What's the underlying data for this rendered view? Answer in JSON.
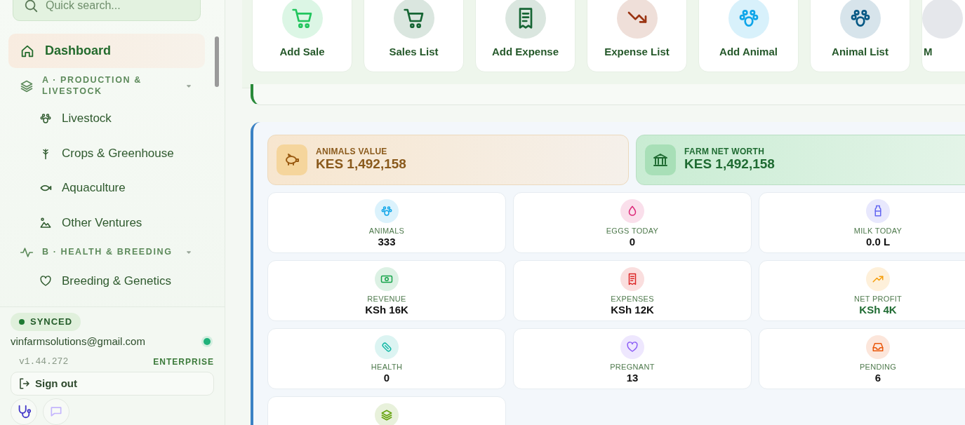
{
  "sidebar": {
    "search": {
      "placeholder": "Quick search..."
    },
    "items": [
      {
        "kind": "link",
        "label": "Dashboard",
        "selected": true
      },
      {
        "kind": "section",
        "label": "A · PRODUCTION & LIVESTOCK",
        "expanded": true,
        "children": [
          {
            "kind": "link",
            "label": "Livestock",
            "selected": false
          },
          {
            "kind": "link",
            "label": "Crops & Greenhouse",
            "selected": false
          },
          {
            "kind": "link",
            "label": "Aquaculture",
            "selected": false
          },
          {
            "kind": "link",
            "label": "Other Ventures",
            "selected": false
          }
        ]
      },
      {
        "kind": "section",
        "label": "B · HEALTH & BREEDING",
        "expanded": true,
        "children": [
          {
            "kind": "link",
            "label": "Breeding & Genetics",
            "selected": false
          }
        ]
      }
    ],
    "footer": {
      "sync": "SYNCED",
      "email": "vinfarmsolutions@gmail.com",
      "online": true,
      "version": "v1.44.272",
      "plan": "ENTERPRISE",
      "sign_out": "Sign out"
    }
  },
  "quick_actions": [
    {
      "kind": "cart",
      "label": "Add Sale",
      "color": "#22c55e"
    },
    {
      "kind": "cart",
      "label": "Sales List",
      "color": "#166534"
    },
    {
      "kind": "receipt",
      "label": "Add Expense",
      "color": "#166534"
    },
    {
      "kind": "trend-down",
      "label": "Expense List",
      "color": "#9a3412"
    },
    {
      "kind": "paw",
      "label": "Add Animal",
      "color": "#0ea5e9"
    },
    {
      "kind": "paw",
      "label": "Animal List",
      "color": "#075985"
    },
    {
      "label": "M"
    }
  ],
  "value_cards": [
    {
      "kind": "animals",
      "label": "ANIMALS VALUE",
      "value": "KES 1,492,158"
    },
    {
      "kind": "networth",
      "label": "FARM NET WORTH",
      "value": "KES 1,492,158"
    }
  ],
  "stats": [
    {
      "kind": "paw",
      "label": "ANIMALS",
      "value": "333",
      "color": "#0ea5e9",
      "positive": false
    },
    {
      "kind": "drop",
      "label": "EGGS TODAY",
      "value": "0",
      "color": "#db2777",
      "positive": false
    },
    {
      "kind": "bottle",
      "label": "MILK TODAY",
      "value": "0.0 L",
      "color": "#6366f1",
      "positive": false
    },
    {
      "kind": "money",
      "label": "REVENUE",
      "value": "KSh 16K",
      "color": "#16a34a",
      "positive": false
    },
    {
      "kind": "receipt",
      "label": "EXPENSES",
      "value": "KSh 12K",
      "color": "#dc2626",
      "positive": false
    },
    {
      "kind": "trend-up",
      "label": "NET PROFIT",
      "value": "KSh 4K",
      "color": "#f59e0b",
      "positive": true
    },
    {
      "kind": "pill",
      "label": "HEALTH",
      "value": "0",
      "color": "#14b8a6",
      "positive": false
    },
    {
      "kind": "heart",
      "label": "PREGNANT",
      "value": "13",
      "color": "#8b5cf6",
      "positive": false
    },
    {
      "kind": "inbox",
      "label": "PENDING",
      "value": "6",
      "color": "#ea580c",
      "positive": false
    },
    {
      "kind": "layers",
      "color": "#65a30d"
    }
  ]
}
